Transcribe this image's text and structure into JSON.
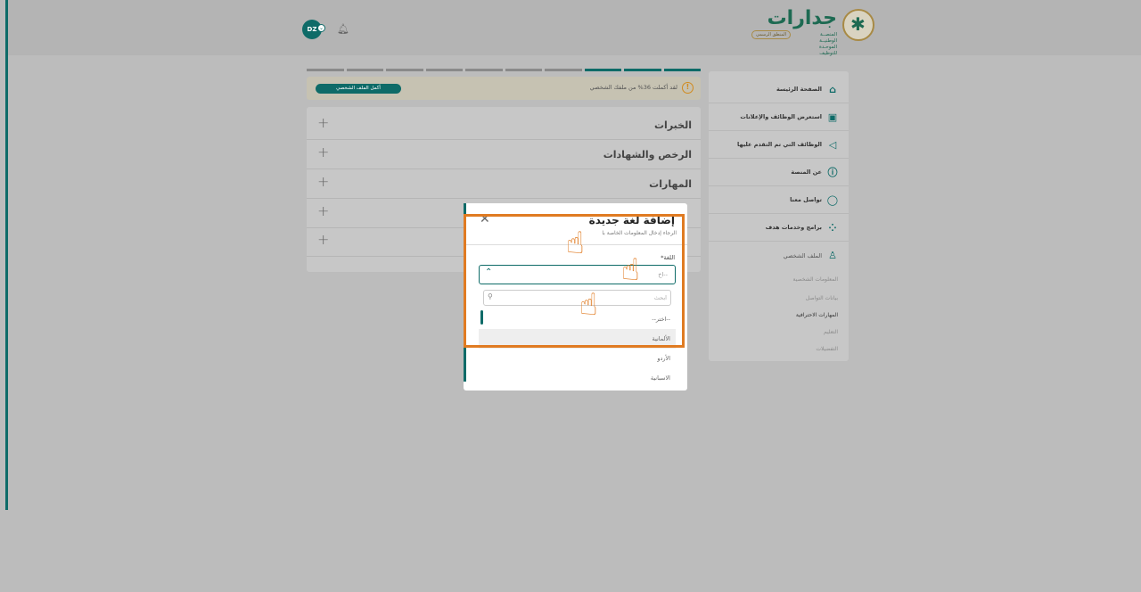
{
  "header": {
    "logo_name": "جدارات",
    "logo_sub": "المنصــة الوطنيــة الموحـدة للتوظيف",
    "logo_badge": "المنطق الرسمي",
    "avatar_initials": "DZ"
  },
  "sidebar": {
    "items": [
      {
        "label": "الصفحة الرئيسة",
        "icon": "home-icon"
      },
      {
        "label": "استعرض الوظائف والإعلانات",
        "icon": "briefcase-icon"
      },
      {
        "label": "الوظائف التي تم التقدم عليها",
        "icon": "send-icon"
      },
      {
        "label": "عن المنصة",
        "icon": "info-icon"
      },
      {
        "label": "تواصل معنا",
        "icon": "chat-icon"
      },
      {
        "label": "برامج وخدمات هدف",
        "icon": "grid-icon"
      },
      {
        "label": "الملف الشخصي",
        "icon": "user-icon"
      }
    ],
    "sub_items": [
      "المعلومات الشخصية",
      "بيانات التواصل",
      "المهارات الاحترافية",
      "التعليم",
      "التفضيلات"
    ]
  },
  "profile": {
    "progress_done": 3,
    "progress_total": 10,
    "notice_text": "لقد أكملت 36% من ملفك الشخصي",
    "complete_button": "أكمل الملف الشخصي",
    "sections": [
      "الخبرات",
      "الرخص والشهادات",
      "المهارات",
      "",
      ""
    ]
  },
  "modal": {
    "title": "إضافة لغة جديدة",
    "subtitle": "الرجاء إدخال المعلومات الخاصة با",
    "field_label": "اللغة*",
    "select_value": "--اخ",
    "search_placeholder": "ابحث",
    "options": [
      "--اختر--",
      "الألمانية",
      "الأردو",
      "الاسبانية"
    ]
  },
  "colors": {
    "brand": "#0e6b68",
    "annotation": "#e07b22",
    "warning": "#d18a1e"
  }
}
